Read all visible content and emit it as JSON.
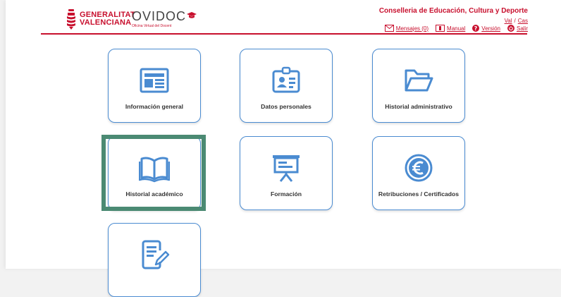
{
  "header": {
    "gva_line1": "GENERALITAT",
    "gva_line2": "VALENCIANA",
    "app_title": "OVIDO",
    "app_title_last": "C",
    "app_subtitle": "Oficina Virtual del Docent",
    "department": "Conselleria de Educación, Cultura y Deporte",
    "lang_val": "Val",
    "lang_sep": "/",
    "lang_cas": "Cas",
    "messages": "Mensajes (0)",
    "manual": "Manual",
    "version": "Versión",
    "logout": "Salir"
  },
  "tiles": [
    {
      "label": "Información general",
      "icon": "newspaper-icon"
    },
    {
      "label": "Datos personales",
      "icon": "id-card-icon"
    },
    {
      "label": "Historial administrativo",
      "icon": "folder-open-icon"
    },
    {
      "label": "Historial académico",
      "icon": "open-book-icon"
    },
    {
      "label": "Formación",
      "icon": "presentation-board-icon"
    },
    {
      "label": "Retribuciones / Certificados",
      "icon": "euro-icon"
    },
    {
      "label": "",
      "icon": "document-edit-icon"
    }
  ],
  "colors": {
    "brand_red": "#c8102e",
    "tile_blue": "#4a8bd1",
    "focus_green": "#4b8a73"
  }
}
